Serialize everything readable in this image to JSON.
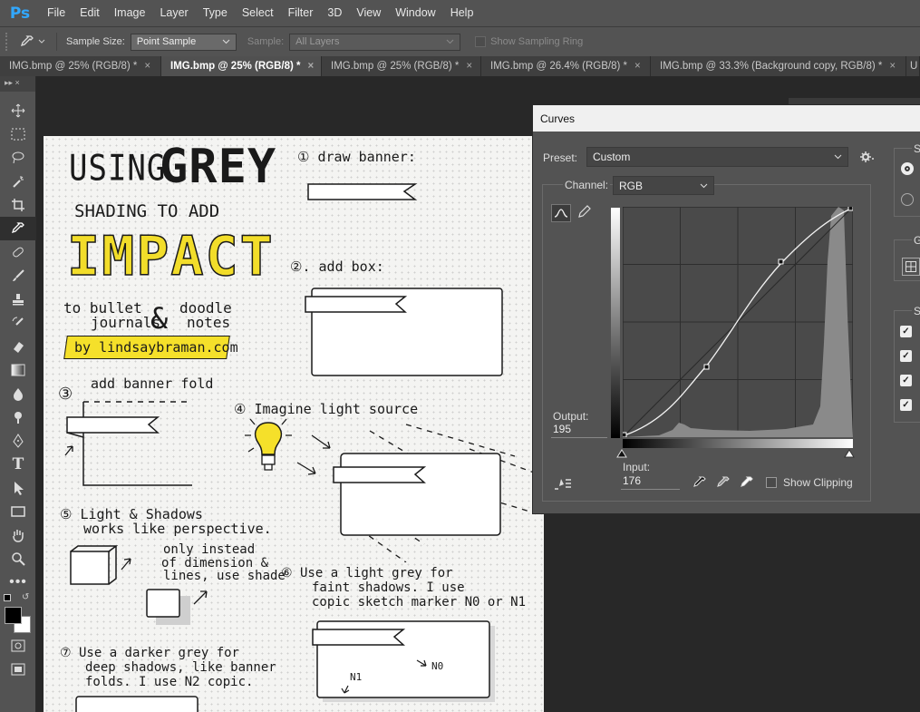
{
  "menubar": {
    "logo": "Ps",
    "items": [
      "File",
      "Edit",
      "Image",
      "Layer",
      "Type",
      "Select",
      "Filter",
      "3D",
      "View",
      "Window",
      "Help"
    ]
  },
  "options": {
    "sample_size_label": "Sample Size:",
    "sample_size_value": "Point Sample",
    "sample_label": "Sample:",
    "sample_value": "All Layers",
    "show_ring_label": "Show Sampling Ring"
  },
  "tabs": [
    {
      "label": "IMG.bmp @ 25% (RGB/8) *",
      "active": false
    },
    {
      "label": "IMG.bmp @ 25% (RGB/8) *",
      "active": true
    },
    {
      "label": "IMG.bmp @ 25% (RGB/8) *",
      "active": false
    },
    {
      "label": "IMG.bmp @ 26.4% (RGB/8) *",
      "active": false
    },
    {
      "label": "IMG.bmp @ 33.3% (Background copy, RGB/8) *",
      "active": false
    }
  ],
  "tab_close_glyph": "×",
  "tab_overflow_label": "U",
  "toolbox_header": "▸▸  ×",
  "canvas": {
    "title_using": "USING",
    "title_grey": "GREY",
    "title_shading": "SHADING TO ADD",
    "title_impact": "IMPACT",
    "sub_to_bullet": "to bullet",
    "sub_journals": "journals",
    "sub_amp": "&",
    "sub_doodle": "doodle",
    "sub_notes": "notes",
    "byline": "by lindsaybraman.com",
    "step1": "① draw banner:",
    "step2": "②. add box:",
    "step3": "③",
    "step3_text": "add banner fold",
    "step4": "④ Imagine light source",
    "step5_a": "⑤ Light & Shadows",
    "step5_b": "works like perspective.",
    "step5_c": "only instead",
    "step5_d": "of dimension &",
    "step5_e": "lines, use shade",
    "step6_a": "⑥ Use a light grey for",
    "step6_b": "faint shadows. I use",
    "step6_c": "copic sketch marker N0 or N1",
    "step7_a": "⑦ Use a darker grey for",
    "step7_b": "deep shadows, like banner",
    "step7_c": "folds. I use N2 copic.",
    "label_n0": "N0",
    "label_n1": "N1"
  },
  "curves": {
    "title": "Curves",
    "preset_label": "Preset:",
    "preset_value": "Custom",
    "channel_label": "Channel:",
    "channel_value": "RGB",
    "output_label": "Output:",
    "output_value": "195",
    "input_label": "Input:",
    "input_value": "176",
    "show_clipping_label": "Show Clipping",
    "side_labels": [
      "S",
      "G",
      "S"
    ]
  },
  "colors": {
    "app_bg": "#282828",
    "panel": "#535353",
    "accent_blue": "#31a8ff",
    "highlight_yellow": "#f5e02a"
  }
}
